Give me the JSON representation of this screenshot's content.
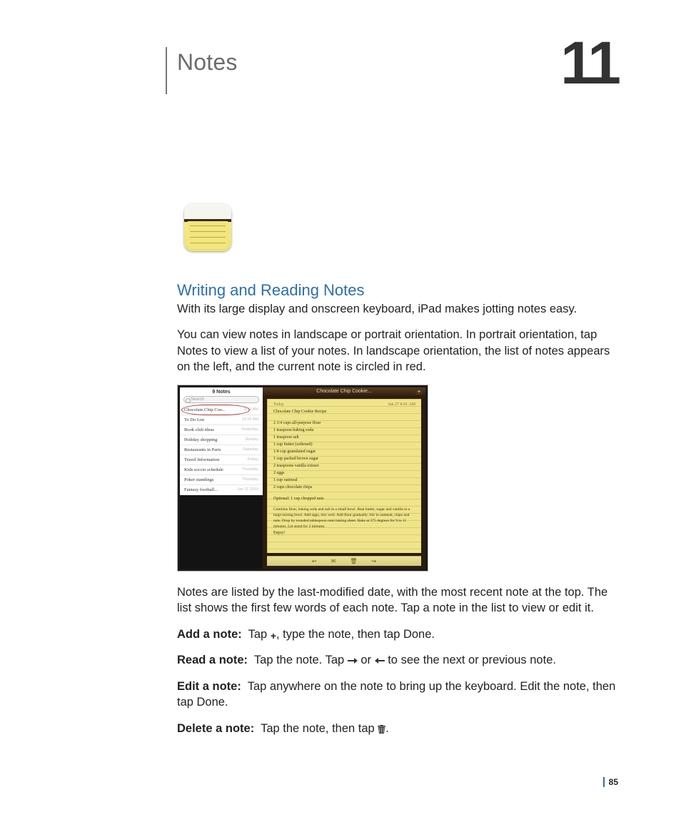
{
  "chapter": {
    "title": "Notes",
    "number": "11"
  },
  "section": {
    "heading": "Writing and Reading Notes"
  },
  "paragraphs": {
    "intro": "With its large display and onscreen keyboard, iPad makes jotting notes easy.",
    "orientation": "You can view notes in landscape or portrait orientation. In portrait orientation, tap Notes to view a list of your notes. In landscape orientation, the list of notes appears on the left, and the current note is circled in red.",
    "listing": "Notes are listed by the last-modified date, with the most recent note at the top. The list shows the first few words of each note. Tap a note in the list to view or edit it."
  },
  "actions": {
    "add": {
      "label": "Add a note:",
      "pre": "Tap ",
      "post": ", type the note, then tap Done."
    },
    "read": {
      "label": "Read a note:",
      "pre": "Tap the note. Tap ",
      "mid": " or ",
      "post": " to see the next or previous note."
    },
    "edit": {
      "label": "Edit a note:",
      "text": "Tap anywhere on the note to bring up the keyboard. Edit the note, then tap Done."
    },
    "delete": {
      "label": "Delete a note:",
      "pre": "Tap the note, then tap ",
      "post": "."
    }
  },
  "figure": {
    "left_title": "9 Notes",
    "search_placeholder": "Search",
    "rows": [
      {
        "title": "Chocolate Chip Coo...",
        "time": "8:11 AM"
      },
      {
        "title": "To Do List",
        "time": "11:03 AM"
      },
      {
        "title": "Book club ideas",
        "time": "Yesterday"
      },
      {
        "title": "Holiday shopping",
        "time": "Sunday"
      },
      {
        "title": "Restaurants in Paris",
        "time": "Saturday"
      },
      {
        "title": "Travel Information",
        "time": "Friday"
      },
      {
        "title": "Kids soccer schedule",
        "time": "Thursday"
      },
      {
        "title": "Poker standings",
        "time": "Thursday"
      },
      {
        "title": "Fantasy football...",
        "time": "Jan 11 2010"
      }
    ],
    "right_title": "Chocolate Chip Cookie...",
    "note_header": {
      "day": "Today",
      "date": "Jan 27  8:41 AM"
    },
    "note_title": "Chocolate Chip Cookie Recipe",
    "ingredients": [
      "2 1/4 cups all-purpose flour",
      "1 teaspoon baking soda",
      "1 teaspoon salt",
      "1 cup butter (softened)",
      "1/4 cup granulated sugar",
      "1 cup packed brown sugar",
      "2 teaspoons vanilla extract",
      "2 eggs",
      "1 cup oatmeal",
      "2 cups chocolate chips"
    ],
    "optional": "Optional: 1 cup chopped nuts",
    "instructions": "Combine flour, baking soda and salt in a small bowl. Beat butter, sugar and vanilla in a large mixing bowl. Add eggs, mix well. Add flour gradually. Stir in oatmeal, chips and nuts. Drop by rounded tablespoon onto baking sheet. Bake at 375 degrees for 9 to 11 minutes. Let stand for 2 minutes.",
    "enjoy": "Enjoy!"
  },
  "page_number": "85"
}
